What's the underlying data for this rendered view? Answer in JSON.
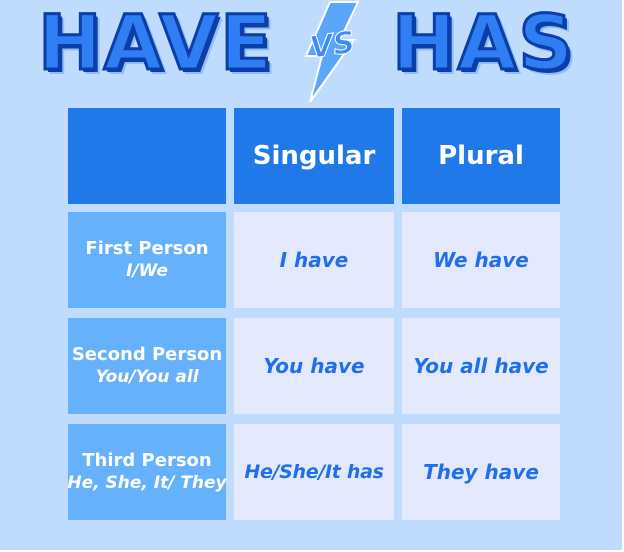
{
  "title": {
    "left_word": "HAVE",
    "vs": "VS",
    "right_word": "HAS"
  },
  "table": {
    "columns": [
      "",
      "Singular",
      "Plural"
    ],
    "rows": [
      {
        "person": "First Person",
        "pronouns": "I/We",
        "singular": "I have",
        "plural": "We have"
      },
      {
        "person": "Second Person",
        "pronouns": "You/You all",
        "singular": "You have",
        "plural": "You all have"
      },
      {
        "person": "Third Person",
        "pronouns": "He, She, It/ They",
        "singular": "He/She/It has",
        "plural": "They have"
      }
    ]
  },
  "colors": {
    "background": "#bfdcff",
    "header_fill": "#2079e9",
    "row_header_fill": "#66b1fb",
    "body_fill": "#e4e9fd",
    "body_text": "#1f70ea",
    "title_fill": "#2f7ef3",
    "title_outline": "#0b3ea8"
  },
  "icons": {
    "vs_badge": "lightning-bolt-icon"
  }
}
